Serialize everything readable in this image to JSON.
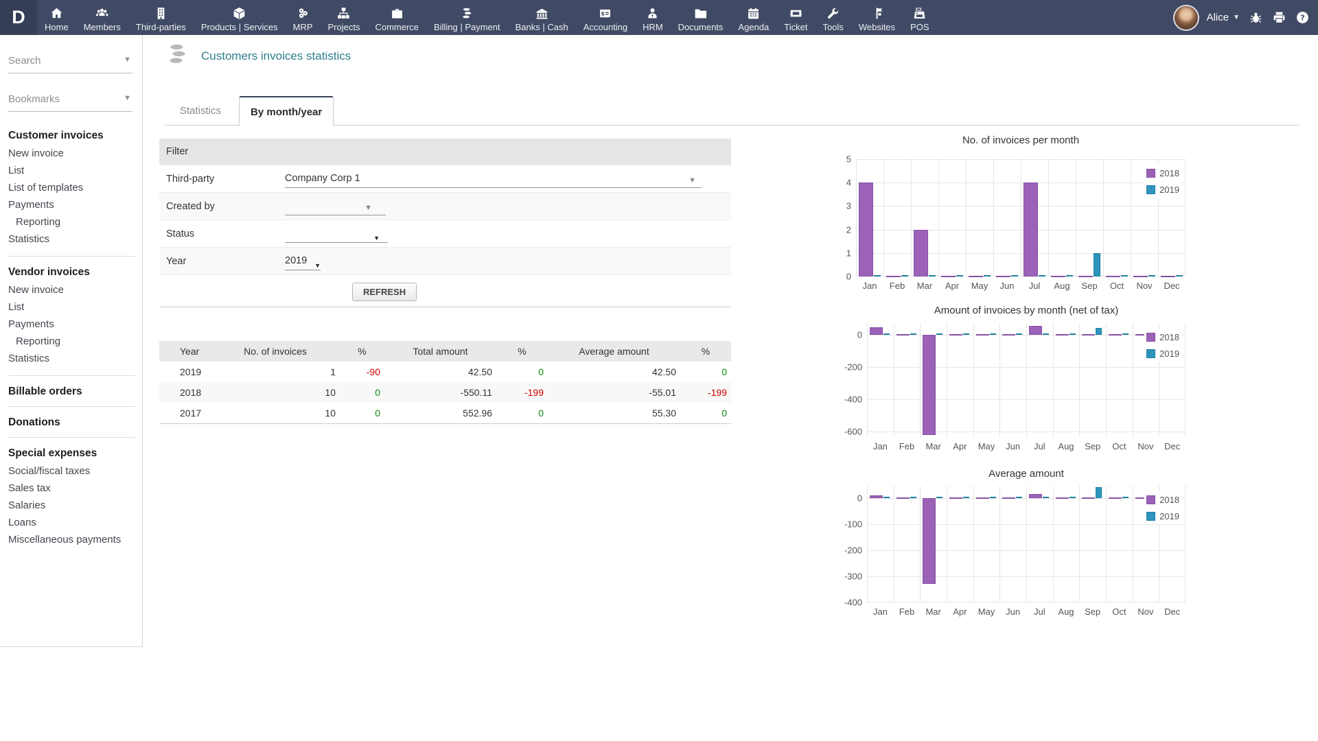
{
  "topbar": {
    "logo": "D",
    "items": [
      {
        "label": "Home",
        "icon": "home-icon"
      },
      {
        "label": "Members",
        "icon": "members-icon"
      },
      {
        "label": "Third-parties",
        "icon": "building-icon"
      },
      {
        "label": "Products | Services",
        "icon": "cube-icon"
      },
      {
        "label": "MRP",
        "icon": "gears-icon"
      },
      {
        "label": "Projects",
        "icon": "sitemap-icon"
      },
      {
        "label": "Commerce",
        "icon": "briefcase-icon"
      },
      {
        "label": "Billing | Payment",
        "icon": "coins-icon"
      },
      {
        "label": "Banks | Cash",
        "icon": "bank-icon"
      },
      {
        "label": "Accounting",
        "icon": "calculator-icon"
      },
      {
        "label": "HRM",
        "icon": "user-tie-icon"
      },
      {
        "label": "Documents",
        "icon": "folder-icon"
      },
      {
        "label": "Agenda",
        "icon": "calendar-icon"
      },
      {
        "label": "Ticket",
        "icon": "ticket-icon"
      },
      {
        "label": "Tools",
        "icon": "wrench-icon"
      },
      {
        "label": "Websites",
        "icon": "globe-icon"
      },
      {
        "label": "POS",
        "icon": "cash-register-icon"
      }
    ],
    "user": {
      "name": "Alice"
    },
    "right_icons": [
      "bug-icon",
      "printer-icon",
      "help-icon"
    ]
  },
  "sidebar": {
    "search_placeholder": "Search",
    "bookmarks_placeholder": "Bookmarks",
    "sections": [
      {
        "title": "Customer invoices",
        "items": [
          {
            "label": "New invoice",
            "indent": false
          },
          {
            "label": "List",
            "indent": false
          },
          {
            "label": "List of templates",
            "indent": false
          },
          {
            "label": "Payments",
            "indent": false
          },
          {
            "label": "Reporting",
            "indent": true
          },
          {
            "label": "Statistics",
            "indent": false
          }
        ]
      },
      {
        "title": "Vendor invoices",
        "items": [
          {
            "label": "New invoice",
            "indent": false
          },
          {
            "label": "List",
            "indent": false
          },
          {
            "label": "Payments",
            "indent": false
          },
          {
            "label": "Reporting",
            "indent": true
          },
          {
            "label": "Statistics",
            "indent": false
          }
        ]
      },
      {
        "title": "Billable orders",
        "items": []
      },
      {
        "title": "Donations",
        "items": []
      },
      {
        "title": "Special expenses",
        "items": [
          {
            "label": "Social/fiscal taxes",
            "indent": false
          },
          {
            "label": "Sales tax",
            "indent": false
          },
          {
            "label": "Salaries",
            "indent": false
          },
          {
            "label": "Loans",
            "indent": false
          },
          {
            "label": "Miscellaneous payments",
            "indent": false
          }
        ]
      }
    ]
  },
  "page": {
    "title": "Customers invoices statistics",
    "tabs": [
      {
        "label": "Statistics",
        "active": false
      },
      {
        "label": "By month/year",
        "active": true
      }
    ]
  },
  "filter": {
    "header": "Filter",
    "third_party_label": "Third-party",
    "third_party_value": "Company Corp 1",
    "created_by_label": "Created by",
    "created_by_value": "",
    "status_label": "Status",
    "status_value": "",
    "year_label": "Year",
    "year_value": "2019",
    "refresh_label": "REFRESH"
  },
  "table": {
    "headers": [
      "Year",
      "No. of invoices",
      "%",
      "Total amount",
      "%",
      "Average amount",
      "%"
    ],
    "rows": [
      [
        "2019",
        "1",
        "-90",
        "42.50",
        "0",
        "42.50",
        "0"
      ],
      [
        "2018",
        "10",
        "0",
        "-550.11",
        "-199",
        "-55.01",
        "-199"
      ],
      [
        "2017",
        "10",
        "0",
        "552.96",
        "0",
        "55.30",
        "0"
      ]
    ]
  },
  "colors": {
    "topbar": "#404a64",
    "accent": "#2e7d8d",
    "positive": "#0f8a0f",
    "negative": "#d40000",
    "grid": "#e6e6e6",
    "series": [
      "#9b62b8",
      "#2d95bb"
    ],
    "series_border": [
      "#8751a5",
      "#1f7fa3"
    ]
  },
  "chart_data": [
    {
      "type": "bar",
      "title": "No. of invoices per month",
      "categories": [
        "Jan",
        "Feb",
        "Mar",
        "Apr",
        "May",
        "Jun",
        "Jul",
        "Aug",
        "Sep",
        "Oct",
        "Nov",
        "Dec"
      ],
      "series": [
        {
          "name": "2018",
          "values": [
            4,
            0,
            2,
            0,
            0,
            0,
            4,
            0,
            0,
            0,
            0,
            0
          ]
        },
        {
          "name": "2019",
          "values": [
            0,
            0,
            0,
            0,
            0,
            0,
            0,
            0,
            1,
            0,
            0,
            0
          ]
        }
      ],
      "xlabel": "",
      "ylabel": "",
      "ylim": [
        0,
        5
      ],
      "yticks": [
        0,
        1,
        2,
        3,
        4,
        5
      ],
      "grid": true,
      "legend_position": "top-right"
    },
    {
      "type": "bar",
      "title": "Amount of invoices by month (net of tax)",
      "categories": [
        "Jan",
        "Feb",
        "Mar",
        "Apr",
        "May",
        "Jun",
        "Jul",
        "Aug",
        "Sep",
        "Oct",
        "Nov",
        "Dec"
      ],
      "series": [
        {
          "name": "2018",
          "values": [
            45,
            0,
            -620,
            0,
            0,
            0,
            57,
            0,
            0,
            0,
            0,
            0
          ]
        },
        {
          "name": "2019",
          "values": [
            0,
            0,
            0,
            0,
            0,
            0,
            0,
            0,
            42.5,
            0,
            0,
            0
          ]
        }
      ],
      "xlabel": "",
      "ylabel": "",
      "ylim": [
        -634,
        72
      ],
      "yticks": [
        0,
        -200,
        -400,
        -600
      ],
      "grid": true,
      "legend_position": "top-right"
    },
    {
      "type": "bar",
      "title": "Average amount",
      "categories": [
        "Jan",
        "Feb",
        "Mar",
        "Apr",
        "May",
        "Jun",
        "Jul",
        "Aug",
        "Sep",
        "Oct",
        "Nov",
        "Dec"
      ],
      "series": [
        {
          "name": "2018",
          "values": [
            11,
            0,
            -330,
            0,
            0,
            0,
            15,
            0,
            0,
            0,
            0,
            0
          ]
        },
        {
          "name": "2019",
          "values": [
            0,
            0,
            0,
            0,
            0,
            0,
            0,
            0,
            42.5,
            0,
            0,
            0
          ]
        }
      ],
      "xlabel": "",
      "ylabel": "",
      "ylim": [
        -400,
        47
      ],
      "yticks": [
        0,
        -100,
        -200,
        -300,
        -400
      ],
      "grid": true,
      "legend_position": "top-right"
    }
  ]
}
